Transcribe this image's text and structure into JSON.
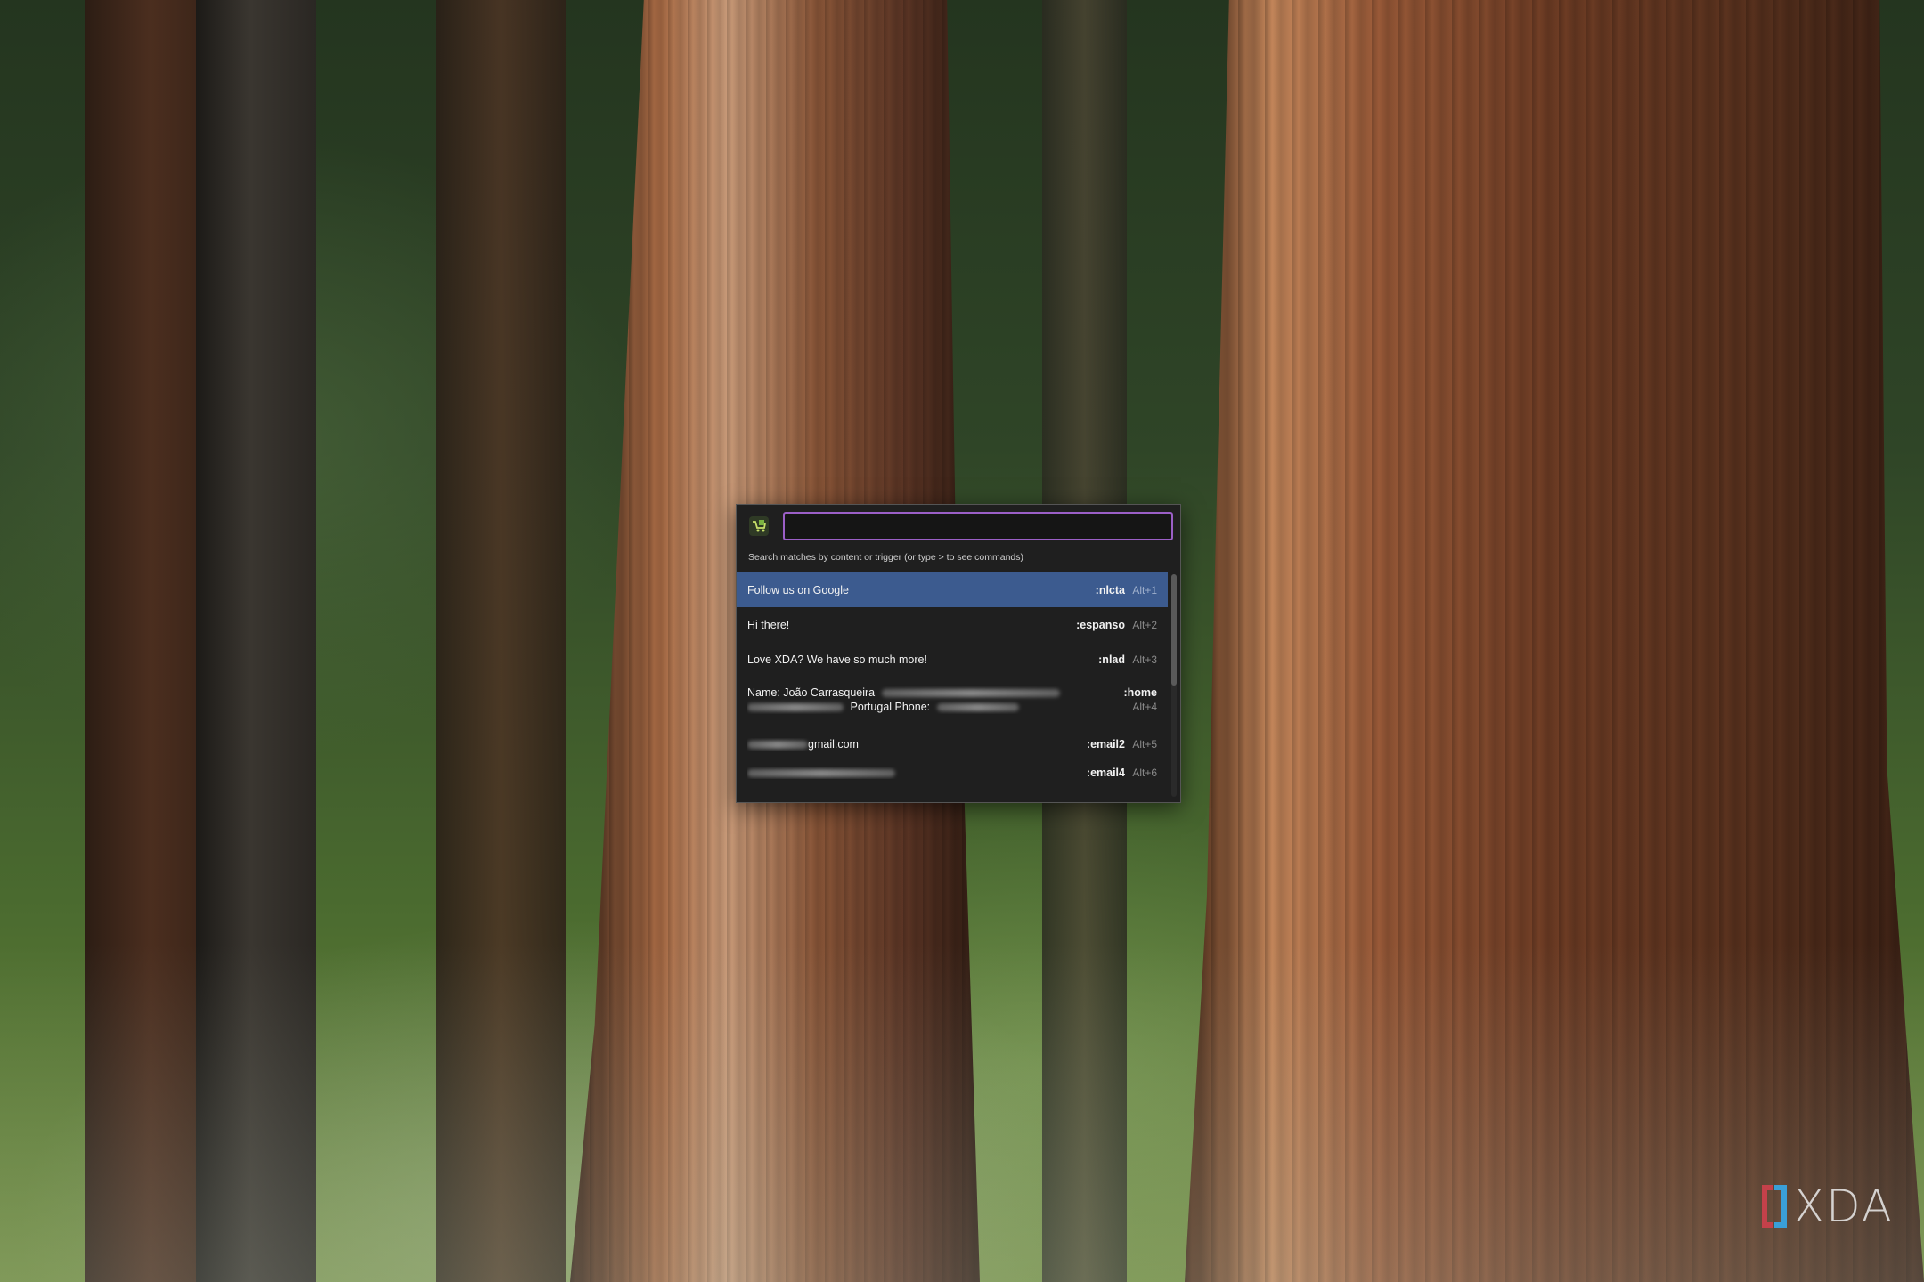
{
  "search": {
    "placeholder": "",
    "value": "",
    "hint": "Search matches by content or trigger (or type > to see commands)"
  },
  "results": [
    {
      "label": "Follow us on Google",
      "trigger": ":nlcta",
      "shortcut": "Alt+1",
      "selected": true
    },
    {
      "label": "Hi there!",
      "trigger": ":espanso",
      "shortcut": "Alt+2"
    },
    {
      "label": "Love XDA? We have so much more!",
      "trigger": ":nlad",
      "shortcut": "Alt+3"
    },
    {
      "label_line1": "Name: João Carrasqueira",
      "label_line2": "Portugal Phone:",
      "trigger": ":home",
      "shortcut": "Alt+4"
    },
    {
      "label": "gmail.com",
      "trigger": ":email2",
      "shortcut": "Alt+5"
    },
    {
      "label": "",
      "trigger": ":email4",
      "shortcut": "Alt+6"
    }
  ],
  "scrollbar_position": 0,
  "watermark": {
    "text": "XDA"
  },
  "colors": {
    "accent_border": "#9b5fc7",
    "selected_row": "#3c5b8f",
    "window_bg": "#1f1f1f"
  },
  "icons": {
    "app": "espanso-icon"
  }
}
